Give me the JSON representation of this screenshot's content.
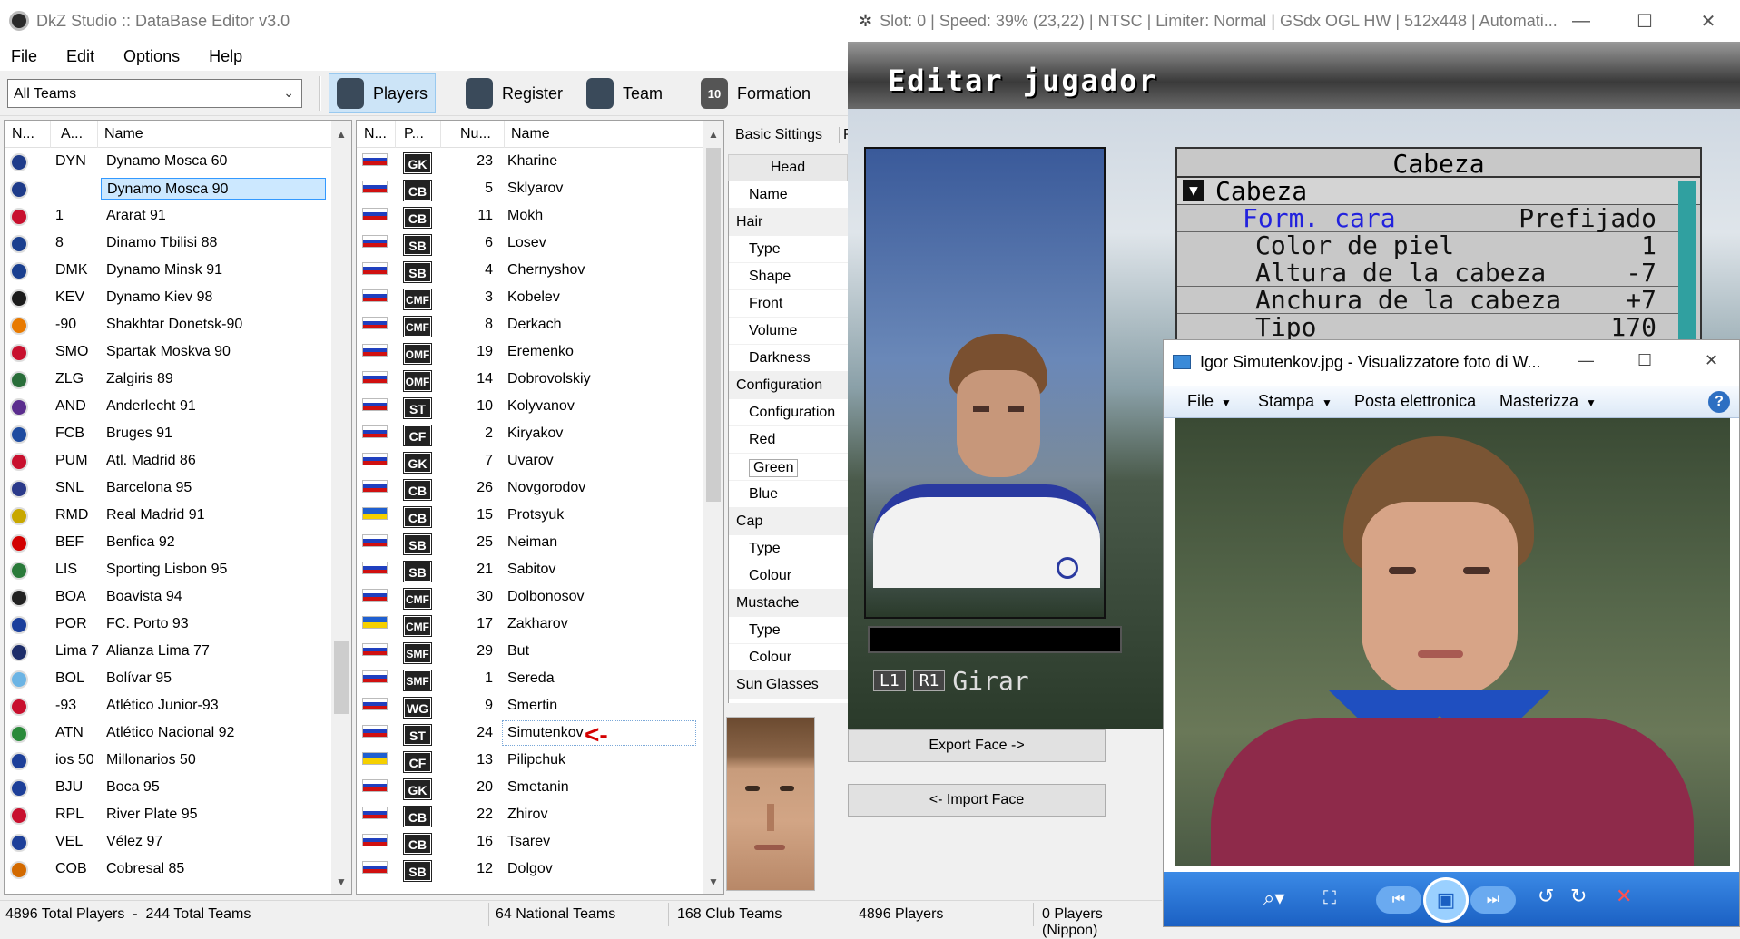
{
  "editor": {
    "title": "DkZ Studio :: DataBase Editor v3.0",
    "menu": [
      "File",
      "Edit",
      "Options",
      "Help"
    ],
    "team_filter": "All Teams",
    "toolbar": [
      {
        "label": "Players",
        "icon": "player-icon",
        "selected": true
      },
      {
        "label": "Register",
        "icon": "register-icon",
        "selected": false
      },
      {
        "label": "Team",
        "icon": "team-icon",
        "selected": false
      },
      {
        "label": "Formation",
        "icon": "formation-icon",
        "selected": false
      }
    ],
    "formation_number": "10",
    "teams_columns": [
      "N...",
      "A...",
      "Name"
    ],
    "teams": [
      {
        "abbr": "DYN",
        "name": "Dynamo Mosca 60",
        "color": "#1f3c8a"
      },
      {
        "abbr": "",
        "name": "Dynamo Mosca 90",
        "color": "#1f3c8a",
        "selected": true
      },
      {
        "abbr": "1",
        "name": "Ararat 91",
        "color": "#c8102e"
      },
      {
        "abbr": "8",
        "name": "Dinamo Tbilisi 88",
        "color": "#1a3f8f"
      },
      {
        "abbr": "DMK",
        "name": "Dynamo Minsk 91",
        "color": "#1a3f8f"
      },
      {
        "abbr": "KEV",
        "name": "Dynamo Kiev 98",
        "color": "#1b1b1b"
      },
      {
        "abbr": "-90",
        "name": "Shakhtar Donetsk-90",
        "color": "#e87a00"
      },
      {
        "abbr": "SMO",
        "name": "Spartak Moskva 90",
        "color": "#c8102e"
      },
      {
        "abbr": "ZLG",
        "name": "Zalgiris 89",
        "color": "#2a6e3a"
      },
      {
        "abbr": "AND",
        "name": "Anderlecht 91",
        "color": "#5b2d8e"
      },
      {
        "abbr": "FCB",
        "name": "Bruges 91",
        "color": "#1e4ba0"
      },
      {
        "abbr": "PUM",
        "name": "Atl. Madrid 86",
        "color": "#c8102e"
      },
      {
        "abbr": "SNL",
        "name": "Barcelona 95",
        "color": "#2b3a8a"
      },
      {
        "abbr": "RMD",
        "name": "Real Madrid 91",
        "color": "#c8a800"
      },
      {
        "abbr": "BEF",
        "name": "Benfica 92",
        "color": "#d20000"
      },
      {
        "abbr": "LIS",
        "name": "Sporting Lisbon 95",
        "color": "#2a7a3a"
      },
      {
        "abbr": "BOA",
        "name": "Boavista 94",
        "color": "#222222"
      },
      {
        "abbr": "POR",
        "name": "FC. Porto 93",
        "color": "#1b3f9c"
      },
      {
        "abbr": "Lima 7",
        "name": "Alianza Lima 77",
        "color": "#1d2d6a"
      },
      {
        "abbr": "BOL",
        "name": "Bolívar 95",
        "color": "#6cb4e4"
      },
      {
        "abbr": "-93",
        "name": "Atlético Junior-93",
        "color": "#c8102e"
      },
      {
        "abbr": "ATN",
        "name": "Atlético Nacional 92",
        "color": "#2a8a3a"
      },
      {
        "abbr": "ios 50",
        "name": "Millonarios 50",
        "color": "#1d3f99"
      },
      {
        "abbr": "BJU",
        "name": "Boca 95",
        "color": "#1d3f99"
      },
      {
        "abbr": "RPL",
        "name": "River Plate 95",
        "color": "#c8102e"
      },
      {
        "abbr": "VEL",
        "name": "Vélez 97",
        "color": "#1d3f99"
      },
      {
        "abbr": "COB",
        "name": "Cobresal 85",
        "color": "#d36a00"
      }
    ],
    "players_columns": [
      "N...",
      "P...",
      "Nu...",
      "Name"
    ],
    "players": [
      {
        "pos": "GK",
        "num": "23",
        "name": "Kharine",
        "flag": "ru"
      },
      {
        "pos": "CB",
        "num": "5",
        "name": "Sklyarov",
        "flag": "ru"
      },
      {
        "pos": "CB",
        "num": "11",
        "name": "Mokh",
        "flag": "ru"
      },
      {
        "pos": "SB",
        "num": "6",
        "name": "Losev",
        "flag": "ru"
      },
      {
        "pos": "SB",
        "num": "4",
        "name": "Chernyshov",
        "flag": "ru"
      },
      {
        "pos": "CMF",
        "num": "3",
        "name": "Kobelev",
        "flag": "ru"
      },
      {
        "pos": "CMF",
        "num": "8",
        "name": "Derkach",
        "flag": "ru"
      },
      {
        "pos": "OMF",
        "num": "19",
        "name": "Eremenko",
        "flag": "ru"
      },
      {
        "pos": "OMF",
        "num": "14",
        "name": "Dobrovolskiy",
        "flag": "ru"
      },
      {
        "pos": "ST",
        "num": "10",
        "name": "Kolyvanov",
        "flag": "ru"
      },
      {
        "pos": "CF",
        "num": "2",
        "name": "Kiryakov",
        "flag": "ru"
      },
      {
        "pos": "GK",
        "num": "7",
        "name": "Uvarov",
        "flag": "ru"
      },
      {
        "pos": "CB",
        "num": "26",
        "name": "Novgorodov",
        "flag": "ru"
      },
      {
        "pos": "CB",
        "num": "15",
        "name": "Protsyuk",
        "flag": "ua"
      },
      {
        "pos": "SB",
        "num": "25",
        "name": "Neiman",
        "flag": "ru"
      },
      {
        "pos": "SB",
        "num": "21",
        "name": "Sabitov",
        "flag": "ru"
      },
      {
        "pos": "CMF",
        "num": "30",
        "name": "Dolbonosov",
        "flag": "ru"
      },
      {
        "pos": "CMF",
        "num": "17",
        "name": "Zakharov",
        "flag": "ua"
      },
      {
        "pos": "SMF",
        "num": "29",
        "name": "But",
        "flag": "ru"
      },
      {
        "pos": "SMF",
        "num": "1",
        "name": "Sereda",
        "flag": "ru"
      },
      {
        "pos": "WG",
        "num": "9",
        "name": "Smertin",
        "flag": "ru"
      },
      {
        "pos": "ST",
        "num": "24",
        "name": "Simutenkov",
        "flag": "ru",
        "selected": true
      },
      {
        "pos": "CF",
        "num": "13",
        "name": "Pilipchuk",
        "flag": "ua"
      },
      {
        "pos": "GK",
        "num": "20",
        "name": "Smetanin",
        "flag": "ru"
      },
      {
        "pos": "CB",
        "num": "22",
        "name": "Zhirov",
        "flag": "ru"
      },
      {
        "pos": "CB",
        "num": "16",
        "name": "Tsarev",
        "flag": "ru"
      },
      {
        "pos": "SB",
        "num": "12",
        "name": "Dolgov",
        "flag": "ru"
      }
    ],
    "arrow_left": "<-",
    "arrow_right": "->",
    "settings_tabs": [
      "Basic Sittings",
      "Pe"
    ],
    "settings_header": "Head",
    "properties": [
      {
        "label": "Name",
        "cat": false
      },
      {
        "label": "Hair",
        "cat": true
      },
      {
        "label": "Type",
        "cat": false
      },
      {
        "label": "Shape",
        "cat": false
      },
      {
        "label": "Front",
        "cat": false
      },
      {
        "label": "Volume",
        "cat": false
      },
      {
        "label": "Darkness",
        "cat": false
      },
      {
        "label": "Configuration",
        "cat": true
      },
      {
        "label": "Configuration",
        "cat": false
      },
      {
        "label": "Red",
        "cat": false
      },
      {
        "label": "Green",
        "cat": false,
        "selected": true
      },
      {
        "label": "Blue",
        "cat": false
      },
      {
        "label": "Cap",
        "cat": true
      },
      {
        "label": "Type",
        "cat": false
      },
      {
        "label": "Colour",
        "cat": false
      },
      {
        "label": "Mustache",
        "cat": true
      },
      {
        "label": "Type",
        "cat": false
      },
      {
        "label": "Colour",
        "cat": false
      },
      {
        "label": "Sun Glasses",
        "cat": true
      }
    ],
    "export_button": "Export Face ->",
    "import_button": "<- Import Face",
    "status": {
      "totals": "4896 Total Players  -  244 Total Teams",
      "national": "64 National Teams",
      "club": "168 Club Teams",
      "players": "4896 Players",
      "nippon": "0 Players (Nippon)"
    }
  },
  "emulator": {
    "title": "Slot: 0 | Speed:  39% (23,22) | NTSC | Limiter: Normal | GSdx OGL HW | 512x448 | Automati...",
    "screen_title": "Editar jugador",
    "panel_header": "Cabeza",
    "section": "Cabeza",
    "rows": [
      {
        "label": "Form. cara",
        "value": "Prefijado",
        "highlight": true
      },
      {
        "label": "Color de piel",
        "value": "1"
      },
      {
        "label": "Altura de la cabeza",
        "value": "-7"
      },
      {
        "label": "Anchura de la cabeza",
        "value": "+7"
      },
      {
        "label": "Tipo",
        "value": "170"
      }
    ],
    "hint_l1": "L1",
    "hint_r1": "R1",
    "hint_text": "Girar"
  },
  "viewer": {
    "title": "Igor Simutenkov.jpg - Visualizzatore foto di W...",
    "menu": [
      "File",
      "Stampa",
      "Posta elettronica",
      "Masterizza"
    ],
    "colors": {
      "accent": "#1f6fd1",
      "toolbar": "#2b7de0"
    }
  }
}
